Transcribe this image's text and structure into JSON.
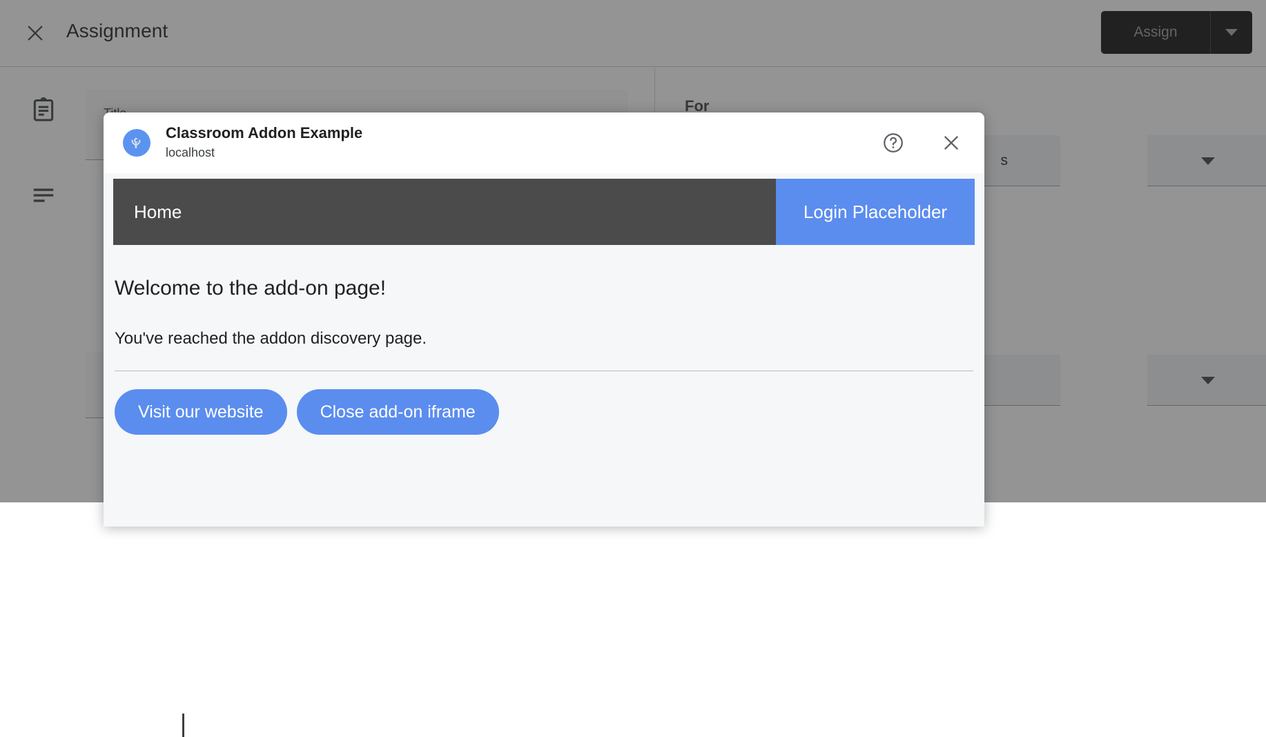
{
  "background": {
    "close_icon": "close-icon",
    "title": "Assignment",
    "assign_button": {
      "label": "Assign",
      "caret_icon": "chevron-down-icon",
      "bg_color": "#0f0f11",
      "text_color": "#9e9e9e"
    },
    "sidebar_icons": [
      {
        "name": "assignment-clipboard-icon"
      },
      {
        "name": "description-lines-icon"
      }
    ],
    "fields": {
      "title_label": "Title",
      "for_label": "For"
    },
    "dropdowns": [
      {
        "value": "s",
        "caret_icon": "chevron-down-icon"
      },
      {
        "value": "",
        "caret_icon": "chevron-down-icon"
      }
    ],
    "overlay_color": "#7c7c7c"
  },
  "dialog": {
    "app_icon": "classroom-addon-logo-icon",
    "app_name": "Classroom Addon Example",
    "origin": "localhost",
    "help_icon": "help-circle-icon",
    "close_icon": "close-icon",
    "iframe": {
      "nav": {
        "home_label": "Home",
        "login_label": "Login Placeholder",
        "nav_bg": "#4b4b4b",
        "login_bg": "#5b8def"
      },
      "heading": "Welcome to the add-on page!",
      "body_text": "You've reached the addon discovery page.",
      "buttons": [
        {
          "label": "Visit our website"
        },
        {
          "label": "Close add-on iframe"
        }
      ],
      "background": "#f5f7f9",
      "accent_color": "#5b8def"
    }
  }
}
